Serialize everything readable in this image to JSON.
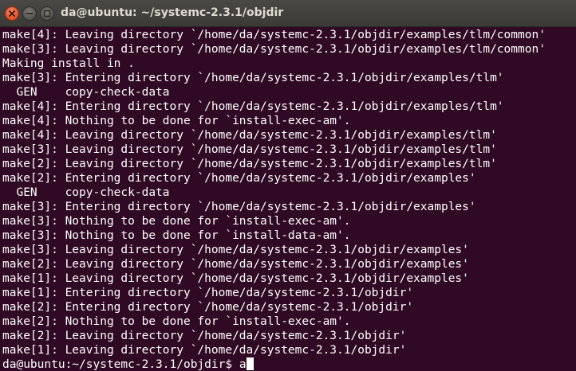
{
  "window": {
    "title": "da@ubuntu: ~/systemc-2.3.1/objdir"
  },
  "terminal": {
    "lines": [
      "make[4]: Leaving directory `/home/da/systemc-2.3.1/objdir/examples/tlm/common'",
      "make[3]: Leaving directory `/home/da/systemc-2.3.1/objdir/examples/tlm/common'",
      "Making install in .",
      "make[3]: Entering directory `/home/da/systemc-2.3.1/objdir/examples/tlm'",
      "  GEN    copy-check-data",
      "make[4]: Entering directory `/home/da/systemc-2.3.1/objdir/examples/tlm'",
      "make[4]: Nothing to be done for `install-exec-am'.",
      "make[4]: Leaving directory `/home/da/systemc-2.3.1/objdir/examples/tlm'",
      "make[3]: Leaving directory `/home/da/systemc-2.3.1/objdir/examples/tlm'",
      "make[2]: Leaving directory `/home/da/systemc-2.3.1/objdir/examples/tlm'",
      "make[2]: Entering directory `/home/da/systemc-2.3.1/objdir/examples'",
      "  GEN    copy-check-data",
      "make[3]: Entering directory `/home/da/systemc-2.3.1/objdir/examples'",
      "make[3]: Nothing to be done for `install-exec-am'.",
      "make[3]: Nothing to be done for `install-data-am'.",
      "make[3]: Leaving directory `/home/da/systemc-2.3.1/objdir/examples'",
      "make[2]: Leaving directory `/home/da/systemc-2.3.1/objdir/examples'",
      "make[1]: Leaving directory `/home/da/systemc-2.3.1/objdir/examples'",
      "make[1]: Entering directory `/home/da/systemc-2.3.1/objdir'",
      "make[2]: Entering directory `/home/da/systemc-2.3.1/objdir'",
      "make[2]: Nothing to be done for `install-exec-am'.",
      "make[2]: Leaving directory `/home/da/systemc-2.3.1/objdir'",
      "make[1]: Leaving directory `/home/da/systemc-2.3.1/objdir'"
    ],
    "prompt": "da@ubuntu:~/systemc-2.3.1/objdir$ ",
    "input": "a"
  },
  "colors": {
    "background": "#300a24",
    "text": "#ffffff",
    "titlebar": "#3c3b37",
    "close_button": "#e2501f"
  },
  "icons": {
    "close": "close-icon",
    "minimize": "minimize-icon",
    "maximize": "maximize-icon"
  }
}
